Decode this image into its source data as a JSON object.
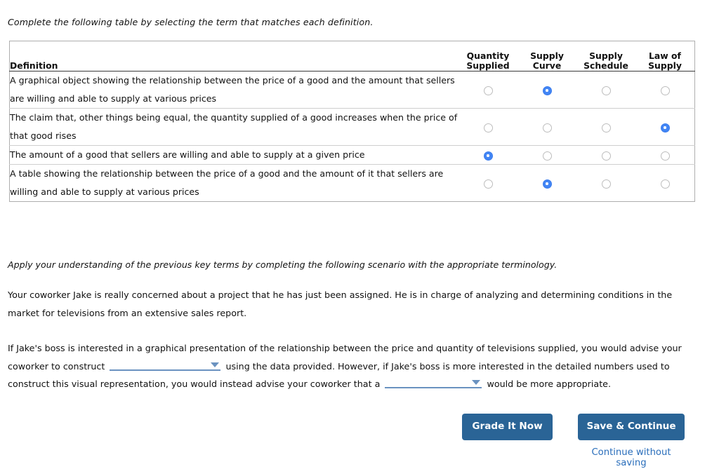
{
  "intro": {
    "text": "Complete the following table by selecting the term that matches each definition."
  },
  "table": {
    "definition_header": "Definition",
    "columns": [
      {
        "line1": "Quantity",
        "line2": "Supplied"
      },
      {
        "line1": "Supply",
        "line2": "Curve"
      },
      {
        "line1": "Supply",
        "line2": "Schedule"
      },
      {
        "line1": "Law of",
        "line2": "Supply"
      }
    ],
    "rows": [
      {
        "definition": "A graphical object showing the relationship between the price of a good and the amount that sellers are willing and able to supply at various prices",
        "selected": 1
      },
      {
        "definition": "The claim that, other things being equal, the quantity supplied of a good increases when the price of that good rises",
        "selected": 3
      },
      {
        "definition": "The amount of a good that sellers are willing and able to supply at a given price",
        "selected": 0
      },
      {
        "definition": "A table showing the relationship between the price of a good and the amount of it that sellers are willing and able to supply at various prices",
        "selected": 1
      }
    ]
  },
  "apply": {
    "text": "Apply your understanding of the previous key terms by completing the following scenario with the appropriate terminology."
  },
  "scenario": {
    "text": "Your coworker Jake is really concerned about a project that he has just been assigned. He is in charge of analyzing and determining conditions in the market for televisions from an extensive sales report."
  },
  "question": {
    "part1": "If Jake's boss is interested in a graphical presentation of the relationship between the price and quantity of televisions supplied, you would advise your coworker to construct",
    "part2": "using the data provided. However, if Jake's boss is more interested in the detailed numbers used to construct this visual representation, you would instead advise your coworker that a",
    "part3": "would be more appropriate.",
    "dropdown1_value": "",
    "dropdown2_value": ""
  },
  "actions": {
    "grade_label": "Grade It Now",
    "save_label": "Save & Continue",
    "continue_without_saving_label": "Continue without saving"
  },
  "colors": {
    "radio_selected": "#4285f4",
    "button_blue": "#2a6496",
    "dropdown_blue": "#6a92c0",
    "link_blue": "#2a6ebb"
  }
}
